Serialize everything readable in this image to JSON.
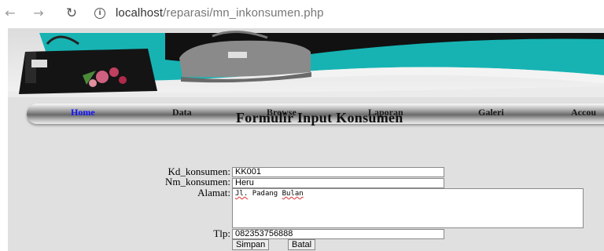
{
  "browser": {
    "back_icon": "←",
    "forward_icon": "→",
    "reload_icon": "↻",
    "info_icon": "i",
    "url_host": "localhost",
    "url_path": "/reparasi/mn_inkonsumen.php"
  },
  "menu": {
    "items": [
      "Home",
      "Data",
      "Browse",
      "Laporan",
      "Galeri",
      "Accou"
    ],
    "active": "Home"
  },
  "form": {
    "title": "Formulir Input Konsumen",
    "kd_label": "Kd_konsumen:",
    "kd_value": "KK001",
    "nm_label": "Nm_konsumen:",
    "nm_value": "Heru",
    "alamat_label": "Alamat:",
    "alamat_words": [
      "Jl.",
      "Padang",
      "Bulan"
    ],
    "tlp_label": "Tlp:",
    "tlp_value": "082353756888",
    "save_label": "Simpan",
    "cancel_label": "Batal"
  },
  "colors": {
    "banner_teal": "#17b3b3",
    "banner_dark": "#111111",
    "menu_active": "#1414ff"
  }
}
